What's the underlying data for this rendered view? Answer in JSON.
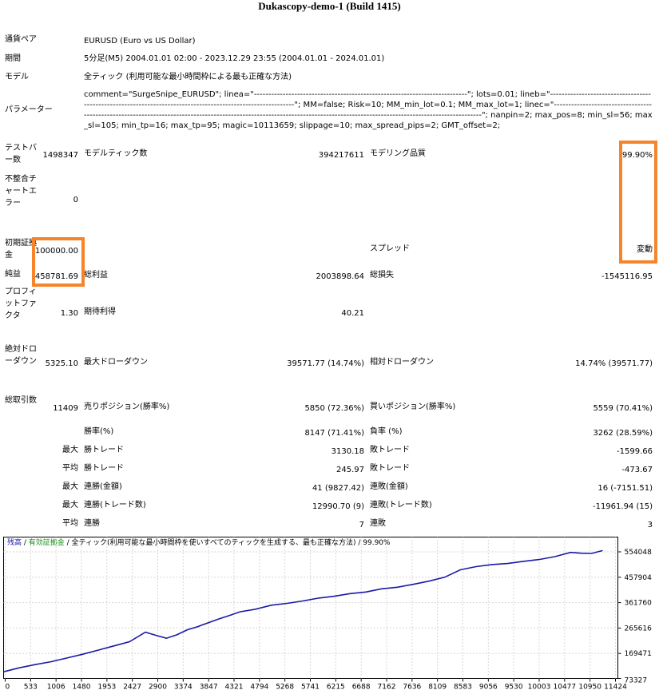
{
  "report_title": "Dukascopy-demo-1 (Build 1415)",
  "settings": {
    "symbol_label": "通貨ペア",
    "symbol_value": "EURUSD (Euro vs US Dollar)",
    "period_label": "期間",
    "period_value": "5分足(M5) 2004.01.01 02:00 - 2023.12.29 23:55 (2004.01.01 - 2024.01.01)",
    "model_label": "モデル",
    "model_value": "全ティック (利用可能な最小時間枠による最も正確な方法)",
    "params_label": "パラメーター",
    "params_value": "comment=\"SurgeSnipe_EURUSD\"; linea=\"--------------------------------------------------------------------------\"; lots=0.01; lineb=\"------------------------------------------------------------------------------------------------------------\"; MM=false; Risk=10; MM_min_lot=0.1; MM_max_lot=1; linec=\"----------------------------------------------------------------------------------------------------------------------------------------------------------------------------\"; nanpin=2; max_pos=8; min_sl=56; max_sl=105; min_tp=16; max_tp=95; magic=10113659; slippage=10; max_spread_pips=2; GMT_offset=2;"
  },
  "stats": {
    "bars_label": "テストバー数",
    "bars_value": "1498347",
    "ticks_label": "モデルティック数",
    "ticks_value": "394217611",
    "quality_label": "モデリング品質",
    "quality_value": "99.90%",
    "mismatch_label": "不整合チャートエラー",
    "mismatch_value": "0",
    "deposit_label": "初期証拠金",
    "deposit_value": "100000.00",
    "spread_label": "スプレッド",
    "spread_value": "変動",
    "net_label": "純益",
    "net_value": "458781.69",
    "gross_profit_label": "総利益",
    "gross_profit_value": "2003898.64",
    "gross_loss_label": "総損失",
    "gross_loss_value": "-1545116.95",
    "pf_label": "プロフィットファクタ",
    "pf_value": "1.30",
    "expected_label": "期待利得",
    "expected_value": "40.21",
    "abs_dd_label": "絶対ドローダウン",
    "abs_dd_value": "5325.10",
    "max_dd_label": "最大ドローダウン",
    "max_dd_value": "39571.77 (14.74%)",
    "rel_dd_label": "相対ドローダウン",
    "rel_dd_value": "14.74% (39571.77)",
    "trades_label": "総取引数",
    "trades_value": "11409",
    "short_label": "売りポジション(勝率%)",
    "short_value": "5850 (72.36%)",
    "long_label": "買いポジション(勝率%)",
    "long_value": "5559 (70.41%)",
    "win_label": "勝率(%)",
    "win_value": "8147 (71.41%)",
    "loss_label": "負率 (%)",
    "loss_value": "3262 (28.59%)",
    "max_prefix": "最大",
    "avg_prefix": "平均",
    "largest_win_label": "勝トレード",
    "largest_win_value": "3130.18",
    "largest_loss_label": "敗トレード",
    "largest_loss_value": "-1599.66",
    "avg_win_label": "勝トレード",
    "avg_win_value": "245.97",
    "avg_loss_label": "敗トレード",
    "avg_loss_value": "-473.67",
    "cons_win_money_label": "連勝(金額)",
    "cons_win_money_value": "41 (9827.42)",
    "cons_loss_money_label": "連敗(金額)",
    "cons_loss_money_value": "16 (-7151.51)",
    "cons_win_count_label": "連勝(トレード数)",
    "cons_win_count_value": "12990.70 (9)",
    "cons_loss_count_label": "連敗(トレード数)",
    "cons_loss_count_value": "-11961.94 (15)",
    "avg_cons_win_label": "連勝",
    "avg_cons_win_value": "7",
    "avg_cons_loss_label": "連敗",
    "avg_cons_loss_value": "3"
  },
  "colors": {
    "highlight": "#f5842a",
    "balance_line": "#1a1aa6",
    "equity_label": "#1a8f1a"
  },
  "chart_data": {
    "type": "line",
    "legend": {
      "balance": "残高",
      "sep1": " / ",
      "equity": "有効証拠金",
      "rest": " / 全ティック(利用可能な最小時間枠を使いすべてのティックを生成する、最も正確な方法) / 99.90%"
    },
    "x_ticks": [
      "0",
      "533",
      "1006",
      "1480",
      "1953",
      "2427",
      "2900",
      "3374",
      "3847",
      "4321",
      "4794",
      "5268",
      "5741",
      "6215",
      "6688",
      "7162",
      "7636",
      "8109",
      "8583",
      "9056",
      "9530",
      "10003",
      "10477",
      "10950",
      "11424"
    ],
    "y_ticks": [
      "554048",
      "457904",
      "361760",
      "265616",
      "169471",
      "73327"
    ],
    "xlim": [
      0,
      11700
    ],
    "ylim": [
      73327,
      554048
    ],
    "series": [
      {
        "x": [
          0,
          300,
          600,
          900,
          1200,
          1500,
          1800,
          2100,
          2400,
          2700,
          2900,
          3100,
          3300,
          3500,
          3700,
          3900,
          4100,
          4300,
          4500,
          4800,
          5100,
          5400,
          5700,
          6000,
          6300,
          6600,
          6900,
          7200,
          7500,
          7800,
          8100,
          8400,
          8700,
          9000,
          9300,
          9600,
          9900,
          10200,
          10500,
          10800,
          11000,
          11200,
          11409
        ],
        "y": [
          100000,
          115000,
          127000,
          138000,
          152000,
          166000,
          182000,
          198000,
          214000,
          250000,
          238000,
          227000,
          240000,
          259000,
          271000,
          286000,
          300000,
          313000,
          327000,
          337000,
          352000,
          359000,
          368000,
          379000,
          386000,
          396000,
          402000,
          414000,
          420000,
          431000,
          443000,
          458000,
          486000,
          498000,
          506000,
          510000,
          518000,
          525000,
          536000,
          552000,
          549000,
          548000,
          558781
        ]
      }
    ]
  }
}
